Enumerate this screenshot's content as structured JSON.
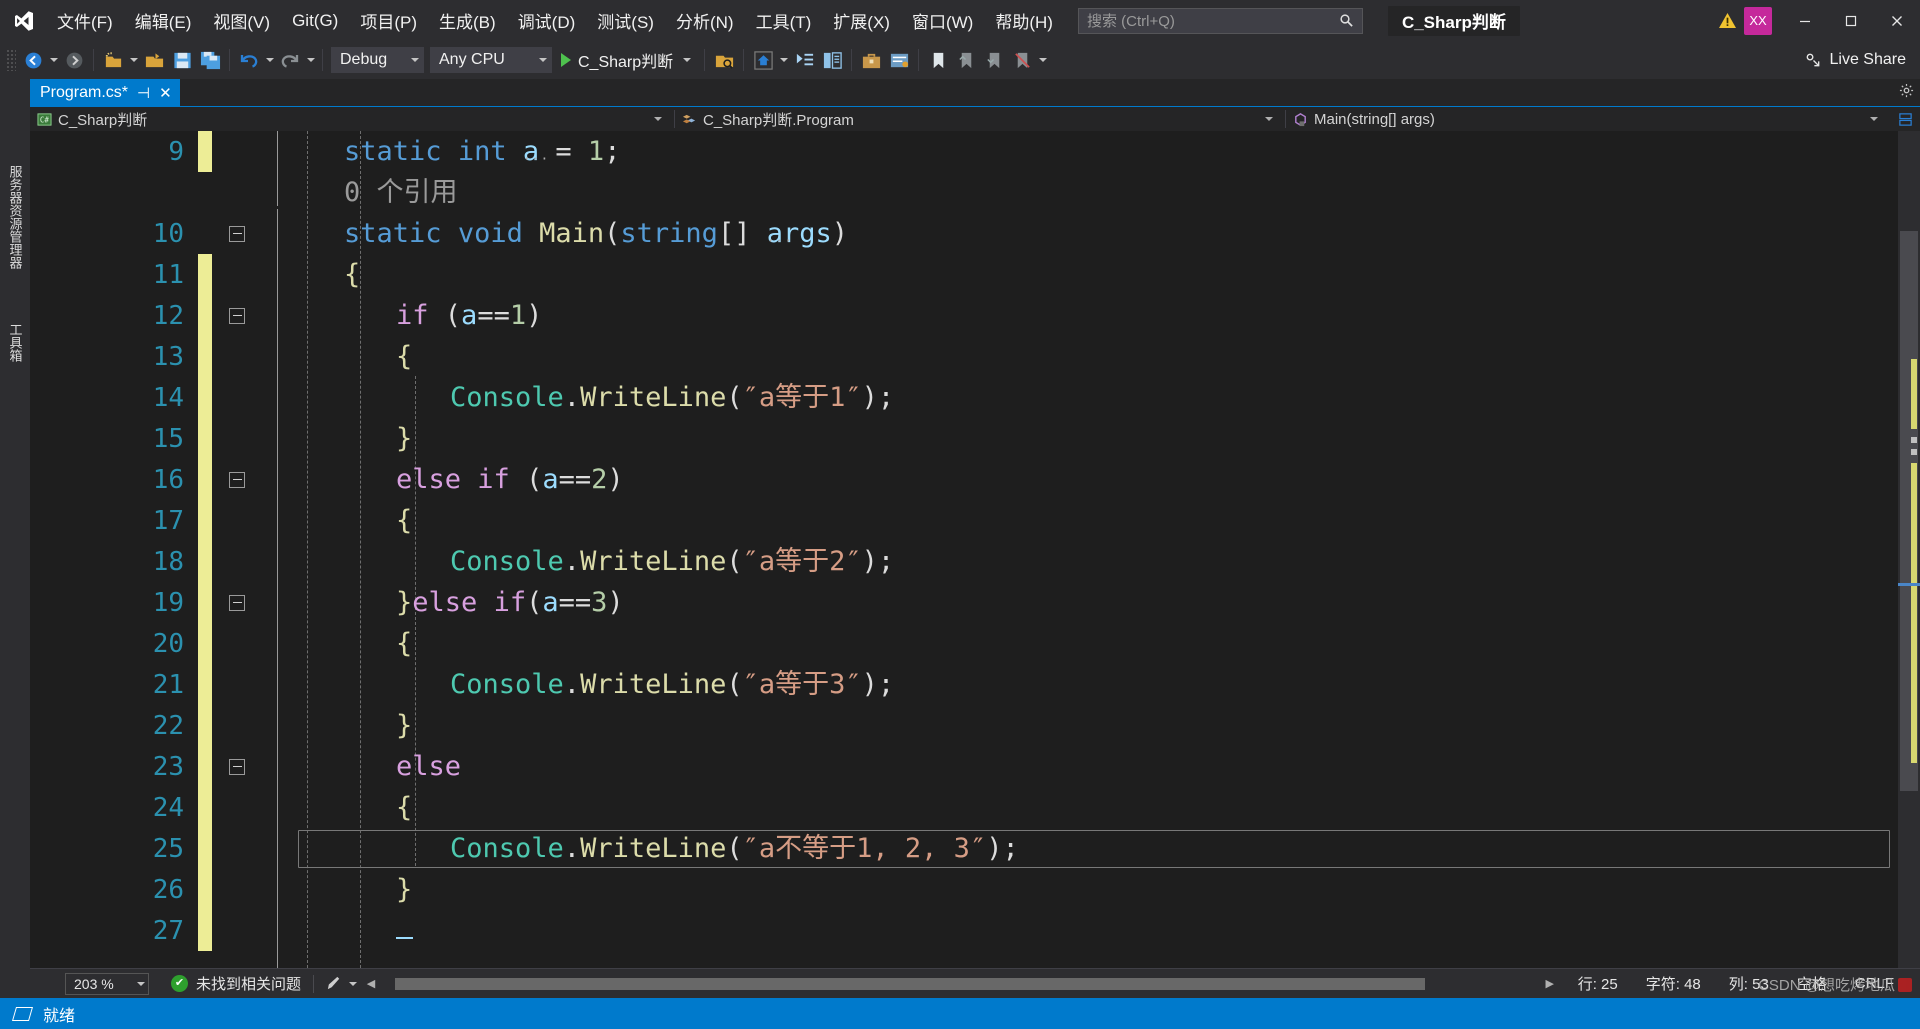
{
  "window": {
    "solution_title": "C_Sharp判断",
    "minimize_label": "—",
    "maximize_label": "▢",
    "close_label": "✕",
    "avatar_initials": "XX"
  },
  "menubar": {
    "items": [
      {
        "label": "文件(F)",
        "name": "menu-file"
      },
      {
        "label": "编辑(E)",
        "name": "menu-edit"
      },
      {
        "label": "视图(V)",
        "name": "menu-view"
      },
      {
        "label": "Git(G)",
        "name": "menu-git"
      },
      {
        "label": "项目(P)",
        "name": "menu-project"
      },
      {
        "label": "生成(B)",
        "name": "menu-build"
      },
      {
        "label": "调试(D)",
        "name": "menu-debug"
      },
      {
        "label": "测试(S)",
        "name": "menu-test"
      },
      {
        "label": "分析(N)",
        "name": "menu-analyze"
      },
      {
        "label": "工具(T)",
        "name": "menu-tools"
      },
      {
        "label": "扩展(X)",
        "name": "menu-extensions"
      },
      {
        "label": "窗口(W)",
        "name": "menu-window"
      },
      {
        "label": "帮助(H)",
        "name": "menu-help"
      }
    ],
    "search_placeholder": "搜索 (Ctrl+Q)",
    "search_value": ""
  },
  "toolbar": {
    "configuration": "Debug",
    "platform": "Any CPU",
    "run_target": "C_Sharp判断",
    "live_share": "Live Share"
  },
  "left_rail": {
    "tabs": [
      {
        "label": "服务器资源管理器",
        "name": "rail-server-explorer"
      },
      {
        "label": "工具箱",
        "name": "rail-toolbox"
      }
    ]
  },
  "document_tabs": [
    {
      "label": "Program.cs*",
      "name": "tab-program-cs",
      "active": true,
      "pin": "⊣",
      "close": "✕"
    }
  ],
  "navbar": {
    "project": "C_Sharp判断",
    "type": "C_Sharp判断.Program",
    "member": "Main(string[] args)"
  },
  "editor": {
    "lines": [
      {
        "num": "9",
        "modified": true,
        "fold": "",
        "indent": 0
      },
      {
        "num": "",
        "modified": false,
        "fold": "",
        "indent": 0
      },
      {
        "num": "10",
        "modified": false,
        "fold": "minus",
        "indent": 0
      },
      {
        "num": "11",
        "modified": true,
        "fold": "",
        "indent": 0
      },
      {
        "num": "12",
        "modified": true,
        "fold": "minus",
        "indent": 0
      },
      {
        "num": "13",
        "modified": true,
        "fold": "",
        "indent": 0
      },
      {
        "num": "14",
        "modified": true,
        "fold": "",
        "indent": 0
      },
      {
        "num": "15",
        "modified": true,
        "fold": "",
        "indent": 0
      },
      {
        "num": "16",
        "modified": true,
        "fold": "minus",
        "indent": 0
      },
      {
        "num": "17",
        "modified": true,
        "fold": "",
        "indent": 0
      },
      {
        "num": "18",
        "modified": true,
        "fold": "",
        "indent": 0
      },
      {
        "num": "19",
        "modified": true,
        "fold": "minus",
        "indent": 0
      },
      {
        "num": "20",
        "modified": true,
        "fold": "",
        "indent": 0
      },
      {
        "num": "21",
        "modified": true,
        "fold": "",
        "indent": 0
      },
      {
        "num": "22",
        "modified": true,
        "fold": "",
        "indent": 0
      },
      {
        "num": "23",
        "modified": true,
        "fold": "minus",
        "indent": 0
      },
      {
        "num": "24",
        "modified": true,
        "fold": "",
        "indent": 0
      },
      {
        "num": "25",
        "modified": true,
        "fold": "",
        "indent": 0
      },
      {
        "num": "26",
        "modified": true,
        "fold": "",
        "indent": 0
      },
      {
        "num": "27",
        "modified": true,
        "fold": "",
        "indent": 0
      }
    ],
    "code_text": [
      "        static int a = 1;",
      "        0 个引用",
      "        static void Main(string[] args)",
      "        {",
      "            if (a==1)",
      "            {",
      "                Console.WriteLine(\"a等于1\");",
      "            }",
      "            else if (a==2)",
      "            {",
      "                Console.WriteLine(\"a等于2\");",
      "            }else if(a==3)",
      "            {",
      "                Console.WriteLine(\"a等于3\");",
      "            }",
      "            else",
      "            {",
      "                Console.WriteLine(\"a不等于1, 2, 3\");",
      "            }",
      "            "
    ],
    "codelens": "0 个引用"
  },
  "edit_status": {
    "zoom": "203 %",
    "problems": "未找到相关问题",
    "row_label": "行: 25",
    "char_label": "字符: 48",
    "col_label": "列: 53",
    "spaces": "空格",
    "eol": "CRLF"
  },
  "statusbar": {
    "ready": "就绪"
  },
  "watermark": {
    "text": "CSDN @想吃烤地瓜"
  },
  "colors": {
    "accent_blue": "#007acc",
    "menu_bg": "#2d2d30",
    "editor_bg": "#1e1e1e",
    "tab_active": "#007acc",
    "change_bar": "#eded96",
    "string": "#d69d85",
    "keyword": "#569cd6",
    "control_keyword": "#d8a0df",
    "type": "#4ec9b0",
    "method": "#dcdcaa",
    "number": "#b5cea8",
    "linenumber": "#2b91af",
    "avatar": "#c5299b"
  }
}
